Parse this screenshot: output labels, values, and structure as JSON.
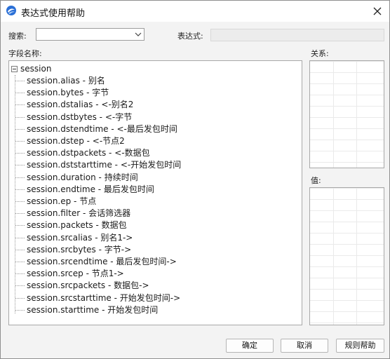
{
  "window": {
    "title": "表达式使用帮助"
  },
  "search": {
    "label": "搜索:",
    "value": "",
    "placeholder": ""
  },
  "expression": {
    "label": "表达式:",
    "value": ""
  },
  "fields": {
    "label": "字段名称:",
    "root": "session",
    "items": [
      "session.alias - 别名",
      "session.bytes - 字节",
      "session.dstalias - <-别名2",
      "session.dstbytes - <-字节",
      "session.dstendtime - <-最后发包时间",
      "session.dstep - <-节点2",
      "session.dstpackets - <-数据包",
      "session.dststarttime - <-开始发包时间",
      "session.duration - 持续时间",
      "session.endtime - 最后发包时间",
      "session.ep - 节点",
      "session.filter - 会话筛选器",
      "session.packets - 数据包",
      "session.srcalias - 别名1->",
      "session.srcbytes - 字节->",
      "session.srcendtime - 最后发包时间->",
      "session.srcep - 节点1->",
      "session.srcpackets - 数据包->",
      "session.srcstarttime - 开始发包时间->",
      "session.starttime - 开始发包时间"
    ]
  },
  "relation": {
    "label": "关系:"
  },
  "value": {
    "label": "值:"
  },
  "buttons": {
    "ok": "确定",
    "cancel": "取消",
    "rule_help": "规则帮助"
  },
  "icons": {
    "app": "app-logo-icon",
    "close": "close-icon",
    "dropdown": "chevron-down-icon",
    "expander": "tree-collapse-icon"
  },
  "colors": {
    "accent": "#2a6fd6",
    "border": "#a8a8a8",
    "titlebar": "#ffffff"
  }
}
